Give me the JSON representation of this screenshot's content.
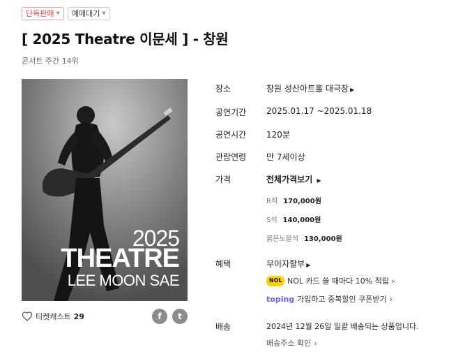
{
  "tags": [
    {
      "label": "단독판매",
      "style": "red"
    },
    {
      "label": "예매대기",
      "style": "gray"
    }
  ],
  "title": "[ 2025 Theatre 이문세 ]  - 창원",
  "subtitle": "콘서트 주간 14위",
  "poster": {
    "year": "2025",
    "word": "THEATRE",
    "artist": "LEE MOON SAE"
  },
  "like": {
    "label": "티켓캐스트",
    "count": "29"
  },
  "share": {
    "facebook": "f",
    "twitter": "t"
  },
  "info": {
    "venue": {
      "label": "장소",
      "value": "창원 성산아트홀 대극장"
    },
    "period": {
      "label": "공연기간",
      "value": "2025.01.17 ~2025.01.18"
    },
    "runtime": {
      "label": "공연시간",
      "value": "120분"
    },
    "age": {
      "label": "관람연령",
      "value": "만 7세이상"
    },
    "price": {
      "label": "가격",
      "all_prices": "전체가격보기",
      "seats": [
        {
          "grade": "R석",
          "price": "170,000원"
        },
        {
          "grade": "S석",
          "price": "140,000원"
        },
        {
          "grade": "붉은노을석",
          "price": "130,000원"
        }
      ]
    },
    "benefit": {
      "label": "혜택",
      "installment": "무이자할부",
      "nol_badge": "NOL",
      "nol_text": "NOL 카드 쓸 때마다 10% 적립",
      "toping_logo": "toping",
      "toping_text": "가입하고 중복할인 쿠폰받기"
    },
    "delivery": {
      "label": "배송",
      "text": "2024년 12월 26일 일괄 배송되는 상품입니다.",
      "address": "배송주소 확인"
    }
  },
  "colors": {
    "accent_red": "#ef3e42",
    "nol_yellow": "#ffd200",
    "toping_purple": "#6a5cff"
  }
}
